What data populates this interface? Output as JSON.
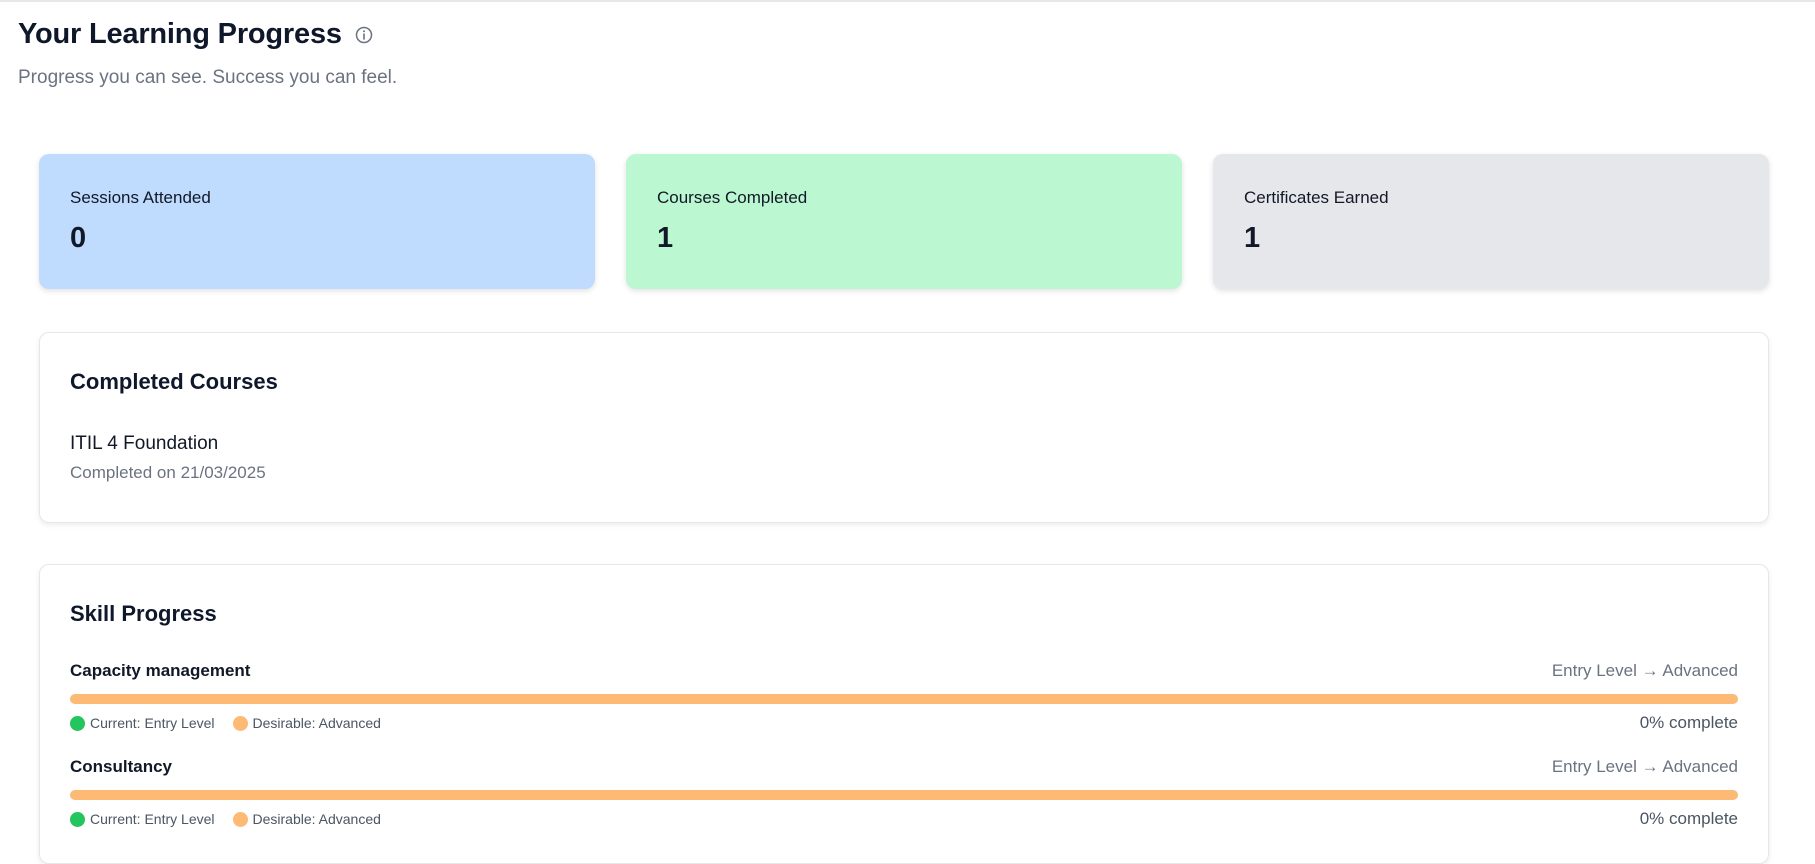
{
  "header": {
    "title": "Your Learning Progress",
    "info_icon": "info-circle-icon",
    "subtitle": "Progress you can see. Success you can feel."
  },
  "stats": [
    {
      "label": "Sessions Attended",
      "value": "0",
      "color": "#bfdbfe"
    },
    {
      "label": "Courses Completed",
      "value": "1",
      "color": "#bbf7d0"
    },
    {
      "label": "Certificates Earned",
      "value": "1",
      "color": "#e5e7eb"
    }
  ],
  "completed_courses": {
    "title": "Completed Courses",
    "items": [
      {
        "name": "ITIL 4 Foundation",
        "completed": "Completed on 21/03/2025"
      }
    ]
  },
  "skill_progress": {
    "title": "Skill Progress",
    "colors": {
      "current": "#22c55e",
      "desirable": "#fdba74"
    },
    "items": [
      {
        "name": "Capacity management",
        "range": "Entry Level → Advanced",
        "current": "Current: Entry Level",
        "desirable": "Desirable: Advanced",
        "percent_text": "0% complete",
        "progress": 0
      },
      {
        "name": "Consultancy",
        "range": "Entry Level → Advanced",
        "current": "Current: Entry Level",
        "desirable": "Desirable: Advanced",
        "percent_text": "0% complete",
        "progress": 0
      }
    ]
  }
}
